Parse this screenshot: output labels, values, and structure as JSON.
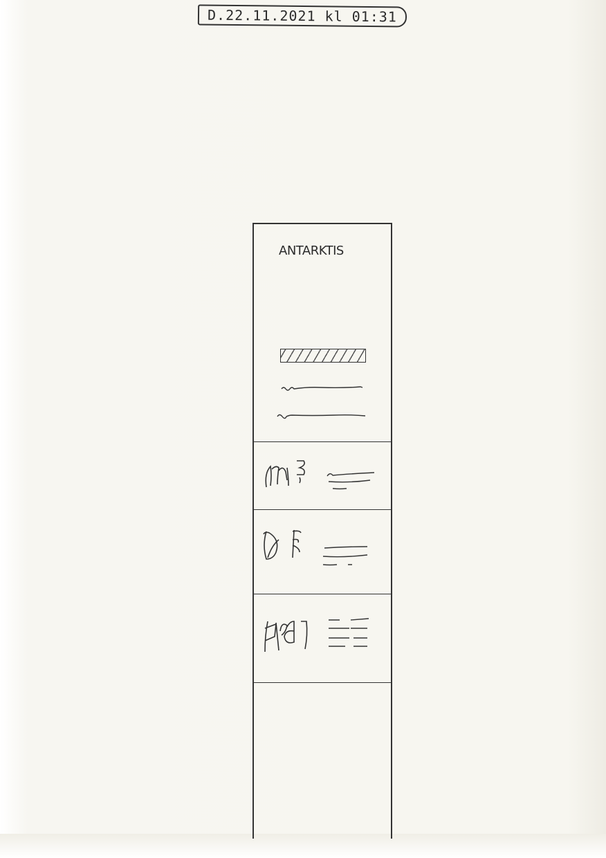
{
  "header": {
    "date_stamp": "D.22.11.2021 kl 01:31"
  },
  "app": {
    "title": "ANTARKTIS",
    "hero": {
      "button_placeholder": "",
      "text_lines": 2
    },
    "cards": [
      {
        "icon": "sketch-glyph-1"
      },
      {
        "icon": "sketch-glyph-2"
      },
      {
        "icon": "sketch-glyph-3"
      }
    ]
  }
}
